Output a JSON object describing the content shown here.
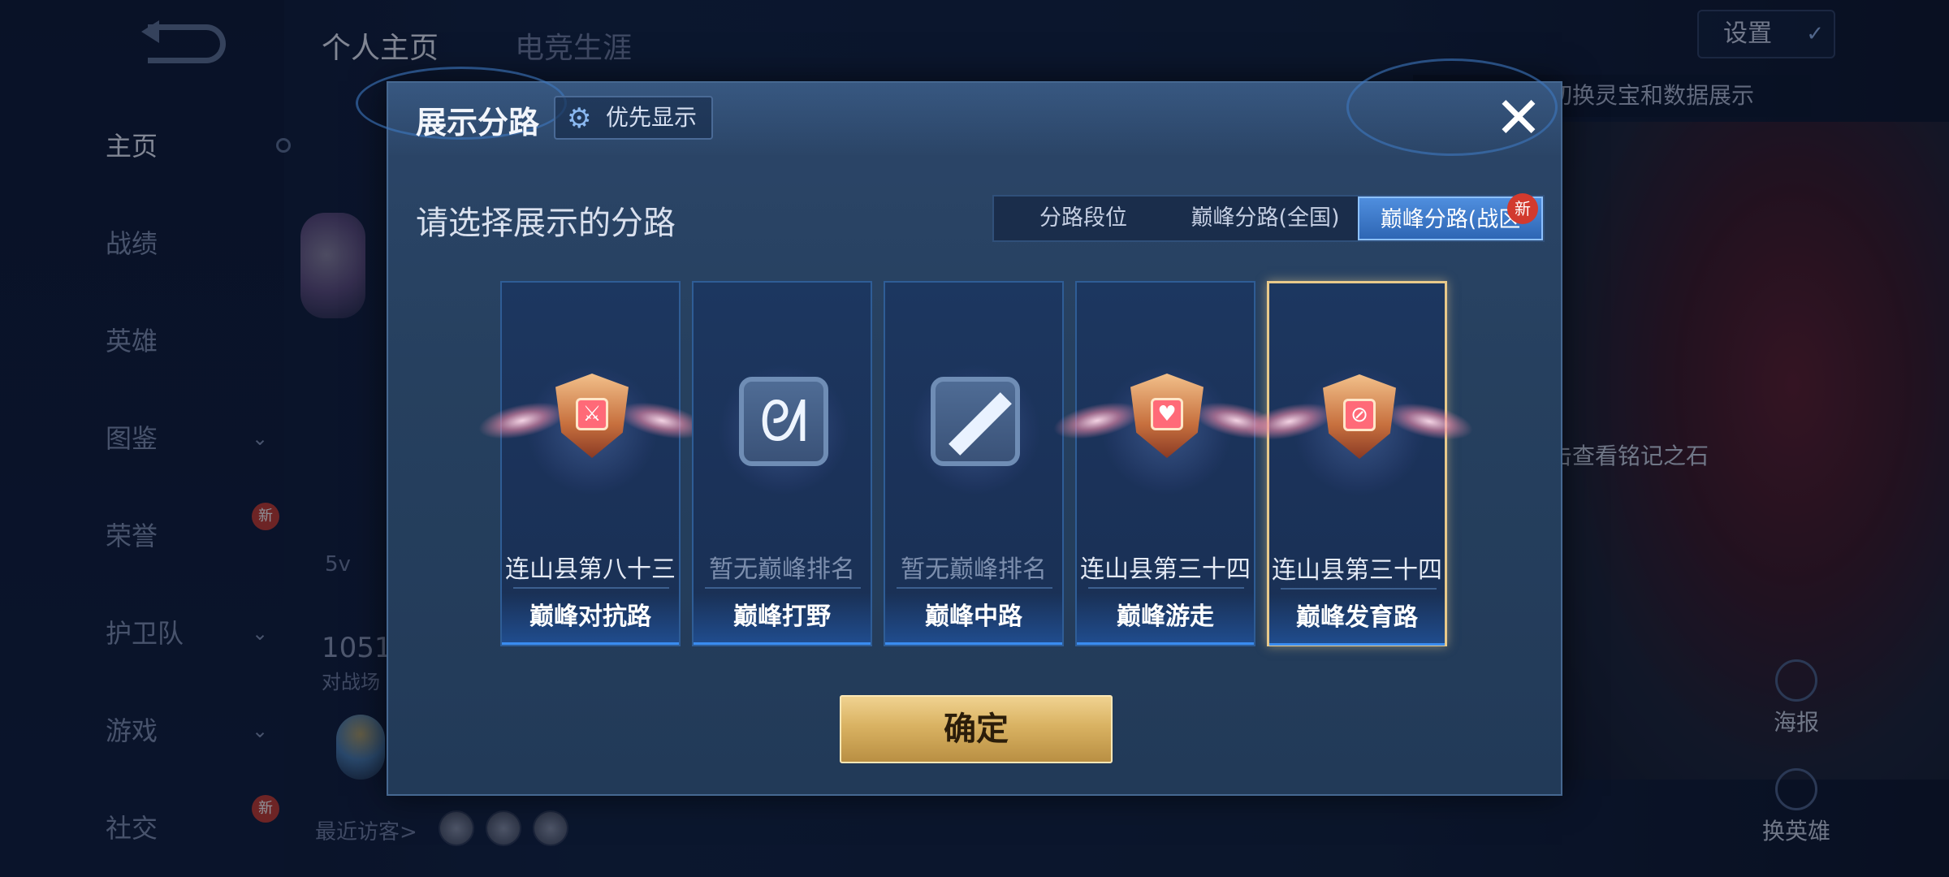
{
  "background": {
    "nav": {
      "items": [
        {
          "label": "主页",
          "active": true
        },
        {
          "label": "战绩"
        },
        {
          "label": "英雄"
        },
        {
          "label": "图鉴",
          "chevron": "⌄"
        },
        {
          "label": "荣誉",
          "chevron": "⌄",
          "badge": "新"
        },
        {
          "label": "护卫队",
          "chevron": "⌄"
        },
        {
          "label": "游戏",
          "chevron": "⌄"
        },
        {
          "label": "社交",
          "chevron": "⌄",
          "badge": "新"
        }
      ]
    },
    "top_tabs": [
      "个人主页",
      "电竞生涯"
    ],
    "settings_label": "设置",
    "hint_text": "以切换灵宝和数据展示",
    "rune_caption": "点击查看铭记之石",
    "actions": {
      "report": "海报",
      "switch_hero": "换英雄"
    },
    "stats": {
      "number": "1051",
      "label": "对战场",
      "short": "5v"
    },
    "visitors_label": "最近访客>"
  },
  "modal": {
    "title": "展示分路",
    "priority_button": "优先显示",
    "section_title": "请选择展示的分路",
    "tabs": [
      {
        "label": "分路段位",
        "active": false
      },
      {
        "label": "巅峰分路(全国)",
        "active": false
      },
      {
        "label": "巅峰分路(战区",
        "active": true,
        "badge": "新"
      }
    ],
    "cards": [
      {
        "rank": "连山县第八十三",
        "lane": "巅峰对抗路",
        "icon": "clash-lane-shield-icon",
        "has_rank": true,
        "selected": false
      },
      {
        "rank": "暂无巅峰排名",
        "lane": "巅峰打野",
        "icon": "jungle-dragon-icon",
        "has_rank": false,
        "selected": false
      },
      {
        "rank": "暂无巅峰排名",
        "lane": "巅峰中路",
        "icon": "mid-lane-slash-icon",
        "has_rank": false,
        "selected": false
      },
      {
        "rank": "连山县第三十四",
        "lane": "巅峰游走",
        "icon": "roam-shield-icon",
        "has_rank": true,
        "selected": false
      },
      {
        "rank": "连山县第三十四",
        "lane": "巅峰发育路",
        "icon": "farm-lane-shield-icon",
        "has_rank": true,
        "selected": true
      }
    ],
    "confirm_label": "确定",
    "close_symbol": "✕",
    "gear_symbol": "⚙"
  },
  "colors": {
    "accent_blue": "#3a8cf0",
    "selected_gold": "#e8c98a",
    "confirm_gold": "#d9b262",
    "badge_red": "#d23a2e"
  }
}
